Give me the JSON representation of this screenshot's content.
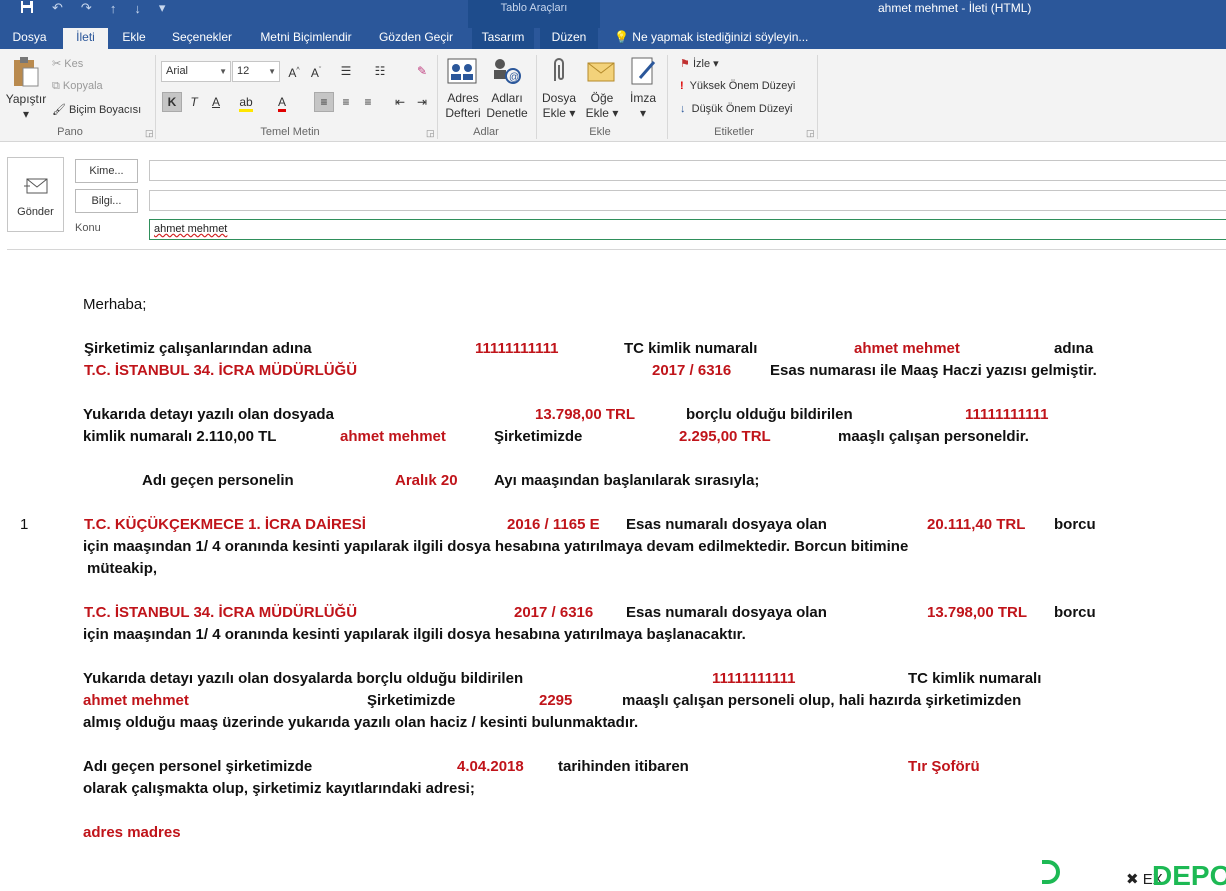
{
  "title_bar": {
    "context_tab_group": "Tablo Araçları",
    "window_title": "ahmet mehmet   - İleti (HTML)"
  },
  "tabs": [
    "Dosya",
    "İleti",
    "Ekle",
    "Seçenekler",
    "Metni Biçimlendir",
    "Gözden Geçir",
    "Tasarım",
    "Düzen"
  ],
  "active_tab": "İleti",
  "tell_me": "Ne yapmak istediğinizi söyleyin...",
  "ribbon": {
    "pano": {
      "label": "Pano",
      "paste": "Yapıştır",
      "cut": "Kes",
      "copy": "Kopyala",
      "format_painter": "Biçim Boyacısı"
    },
    "temel_metin": {
      "label": "Temel Metin",
      "font_name": "Arial",
      "font_size": "12",
      "bold": "K",
      "italic": "T",
      "underline": "A"
    },
    "adlar": {
      "label": "Adlar",
      "address_book_line1": "Adres",
      "address_book_line2": "Defteri",
      "check_names_line1": "Adları",
      "check_names_line2": "Denetle"
    },
    "ekle": {
      "label": "Ekle",
      "attach_file_line1": "Dosya",
      "attach_file_line2": "Ekle",
      "attach_item_line1": "Öğe",
      "attach_item_line2": "Ekle",
      "signature": "İmza"
    },
    "etiketler": {
      "label": "Etiketler",
      "follow_up": "İzle",
      "high_importance": "Yüksek Önem Düzeyi",
      "low_importance": "Düşük Önem Düzeyi"
    }
  },
  "header": {
    "send": "Gönder",
    "to_button": "Kime...",
    "cc_button": "Bilgi...",
    "subject_label": "Konu",
    "to_value": "",
    "cc_value": "",
    "subject_value": "ahmet mehmet"
  },
  "body": {
    "greeting": "Merhaba;",
    "p1": {
      "a": "Şirketimiz çalışanlarından  adına",
      "tc": "11111111111",
      "b": "TC kimlik numaralı",
      "name": "ahmet mehmet",
      "c": "adına",
      "office": "T.C. İSTANBUL 34. İCRA MÜDÜRLÜĞÜ",
      "file": "2017 / 6316",
      "d": "Esas numarası ile Maaş Haczi yazısı gelmiştir."
    },
    "p2": {
      "a": "Yukarıda detayı yazılı olan dosyada",
      "amount": "13.798,00 TRL",
      "b": "borçlu olduğu bildirilen",
      "tc": "11111111111",
      "c": "kimlik numaralı   2.110,00 TL",
      "name": "ahmet mehmet",
      "d": "Şirketimizde",
      "salary": "2.295,00 TRL",
      "e": "maaşlı çalışan personeldir."
    },
    "p3": {
      "a": "Adı geçen personelin",
      "month": "Aralık 20",
      "b": "Ayı maaşından başlanılarak sırasıyla;"
    },
    "item1": {
      "num": "1",
      "office": "T.C. KÜÇÜKÇEKMECE 1. İCRA DAİRESİ",
      "file": "2016 / 1165 E",
      "a": "Esas numaralı dosyaya olan",
      "amount": "20.111,40 TRL",
      "b": "borcu",
      "c": "için maaşından 1/ 4 oranında kesinti yapılarak ilgili dosya hesabına yatırılmaya devam edilmektedir. Borcun bitimine",
      "d": "müteakip,"
    },
    "item2": {
      "office": "T.C. İSTANBUL 34. İCRA MÜDÜRLÜĞÜ",
      "file": "2017 / 6316",
      "a": "Esas numaralı dosyaya olan",
      "amount": "13.798,00 TRL",
      "b": "borcu",
      "c": "için maaşından 1/ 4 oranında kesinti yapılarak ilgili dosya hesabına yatırılmaya başlanacaktır."
    },
    "p4": {
      "a": "Yukarıda detayı yazılı olan dosyalarda borçlu olduğu bildirilen",
      "tc": "11111111111",
      "b": "TC kimlik numaralı",
      "name": "ahmet mehmet",
      "c": "Şirketimizde",
      "salary": "2295",
      "d": "maaşlı çalışan personeli olup, hali hazırda şirketimizden",
      "e": "almış olduğu maaş üzerinde yukarıda yazılı olan haciz / kesinti bulunmaktadır."
    },
    "p5": {
      "a": "Adı geçen personel şirketimizde",
      "date": "4.04.2018",
      "b": "tarihinden itibaren",
      "position": "Tır Şoförü",
      "c": "olarak çalışmakta olup, şirketimiz kayıtlarındaki adresi;"
    },
    "address": "adres madres"
  },
  "watermark": "DEPO",
  "colors": {
    "ribbon_blue": "#2b579a",
    "red_text": "#c0141a",
    "logo_green": "#1db954"
  }
}
